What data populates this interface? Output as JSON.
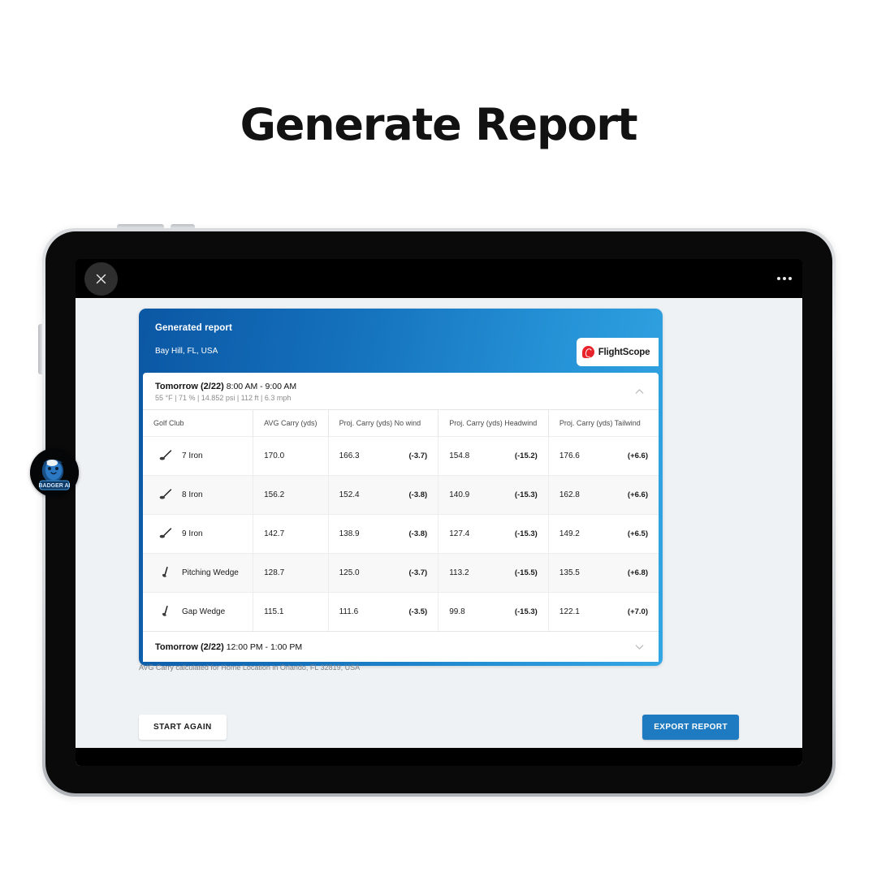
{
  "page": {
    "title": "Generate Report"
  },
  "appbar": {
    "close_icon": "close-icon",
    "more_icon": "more-options-icon"
  },
  "report": {
    "card_title": "Generated report",
    "location": "Bay Hill, FL, USA",
    "brand": "FlightScope",
    "footnote": "AVG Carry calculated for Home Location in Orlando, FL 32819, USA",
    "slot_open": {
      "date": "Tomorrow (2/22)",
      "time": "8:00 AM - 9:00 AM",
      "conditions": "55 °F | 71 % | 14.852 psi | 112 ft | 6.3 mph",
      "chevron": "chevron-up-icon"
    },
    "slot_closed": {
      "date": "Tomorrow (2/22)",
      "time": "12:00 PM - 1:00 PM",
      "chevron": "chevron-down-icon"
    },
    "columns": [
      "Golf Club",
      "AVG Carry (yds)",
      "Proj. Carry (yds) No wind",
      "Proj. Carry (yds) Headwind",
      "Proj. Carry (yds) Tailwind"
    ],
    "rows": [
      {
        "club": "7 Iron",
        "icon": "iron-club-icon",
        "avg": "170.0",
        "nowind": "166.3",
        "nowind_delta": "(-3.7)",
        "head": "154.8",
        "head_delta": "(-15.2)",
        "tail": "176.6",
        "tail_delta": "(+6.6)"
      },
      {
        "club": "8 Iron",
        "icon": "iron-club-icon",
        "avg": "156.2",
        "nowind": "152.4",
        "nowind_delta": "(-3.8)",
        "head": "140.9",
        "head_delta": "(-15.3)",
        "tail": "162.8",
        "tail_delta": "(+6.6)"
      },
      {
        "club": "9 Iron",
        "icon": "iron-club-icon",
        "avg": "142.7",
        "nowind": "138.9",
        "nowind_delta": "(-3.8)",
        "head": "127.4",
        "head_delta": "(-15.3)",
        "tail": "149.2",
        "tail_delta": "(+6.5)"
      },
      {
        "club": "Pitching Wedge",
        "icon": "wedge-club-icon",
        "avg": "128.7",
        "nowind": "125.0",
        "nowind_delta": "(-3.7)",
        "head": "113.2",
        "head_delta": "(-15.5)",
        "tail": "135.5",
        "tail_delta": "(+6.8)"
      },
      {
        "club": "Gap Wedge",
        "icon": "wedge-club-icon",
        "avg": "115.1",
        "nowind": "111.6",
        "nowind_delta": "(-3.5)",
        "head": "99.8",
        "head_delta": "(-15.3)",
        "tail": "122.1",
        "tail_delta": "(+7.0)"
      }
    ]
  },
  "actions": {
    "start_again": "START AGAIN",
    "export_report": "EXPORT REPORT"
  },
  "badger": {
    "name": "BADGER AI",
    "label": "badger-ai-logo"
  },
  "colors": {
    "brand_blue_dark": "#0b57a4",
    "brand_blue_light": "#33a6e4",
    "export_button": "#1f7bc1",
    "flightscope_red": "#e8232a",
    "page_bg": "#eff2f5"
  }
}
